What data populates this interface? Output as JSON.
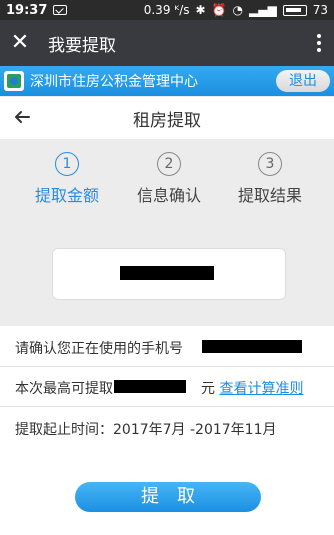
{
  "status_bar": {
    "time": "19:37",
    "speed": "0.39 ᴷ/s",
    "battery": "73"
  },
  "titlebar": {
    "close_icon": "close-icon",
    "title": "我要提取",
    "more_icon": "more-vertical-icon"
  },
  "banner": {
    "logo_icon": "housing-fund-logo",
    "title": "深圳市住房公积金管理中心",
    "logout_label": "退出"
  },
  "page_header": {
    "back_icon": "arrow-left-icon",
    "title": "租房提取"
  },
  "steps": [
    {
      "num": "1",
      "label": "提取金额",
      "active": true
    },
    {
      "num": "2",
      "label": "信息确认",
      "active": false
    },
    {
      "num": "3",
      "label": "提取结果",
      "active": false
    }
  ],
  "info": {
    "phone_prefix": "请确认您正在使用的手机号",
    "max_prefix": "本次最高可提取",
    "max_suffix": "元",
    "rule_link": "查看计算准则",
    "period": "提取起止时间：2017年7月 -2017年11月"
  },
  "submit_label": "提取",
  "colors": {
    "accent": "#1b8fe0",
    "titlebar": "#393a3f",
    "mask": "#000000"
  }
}
